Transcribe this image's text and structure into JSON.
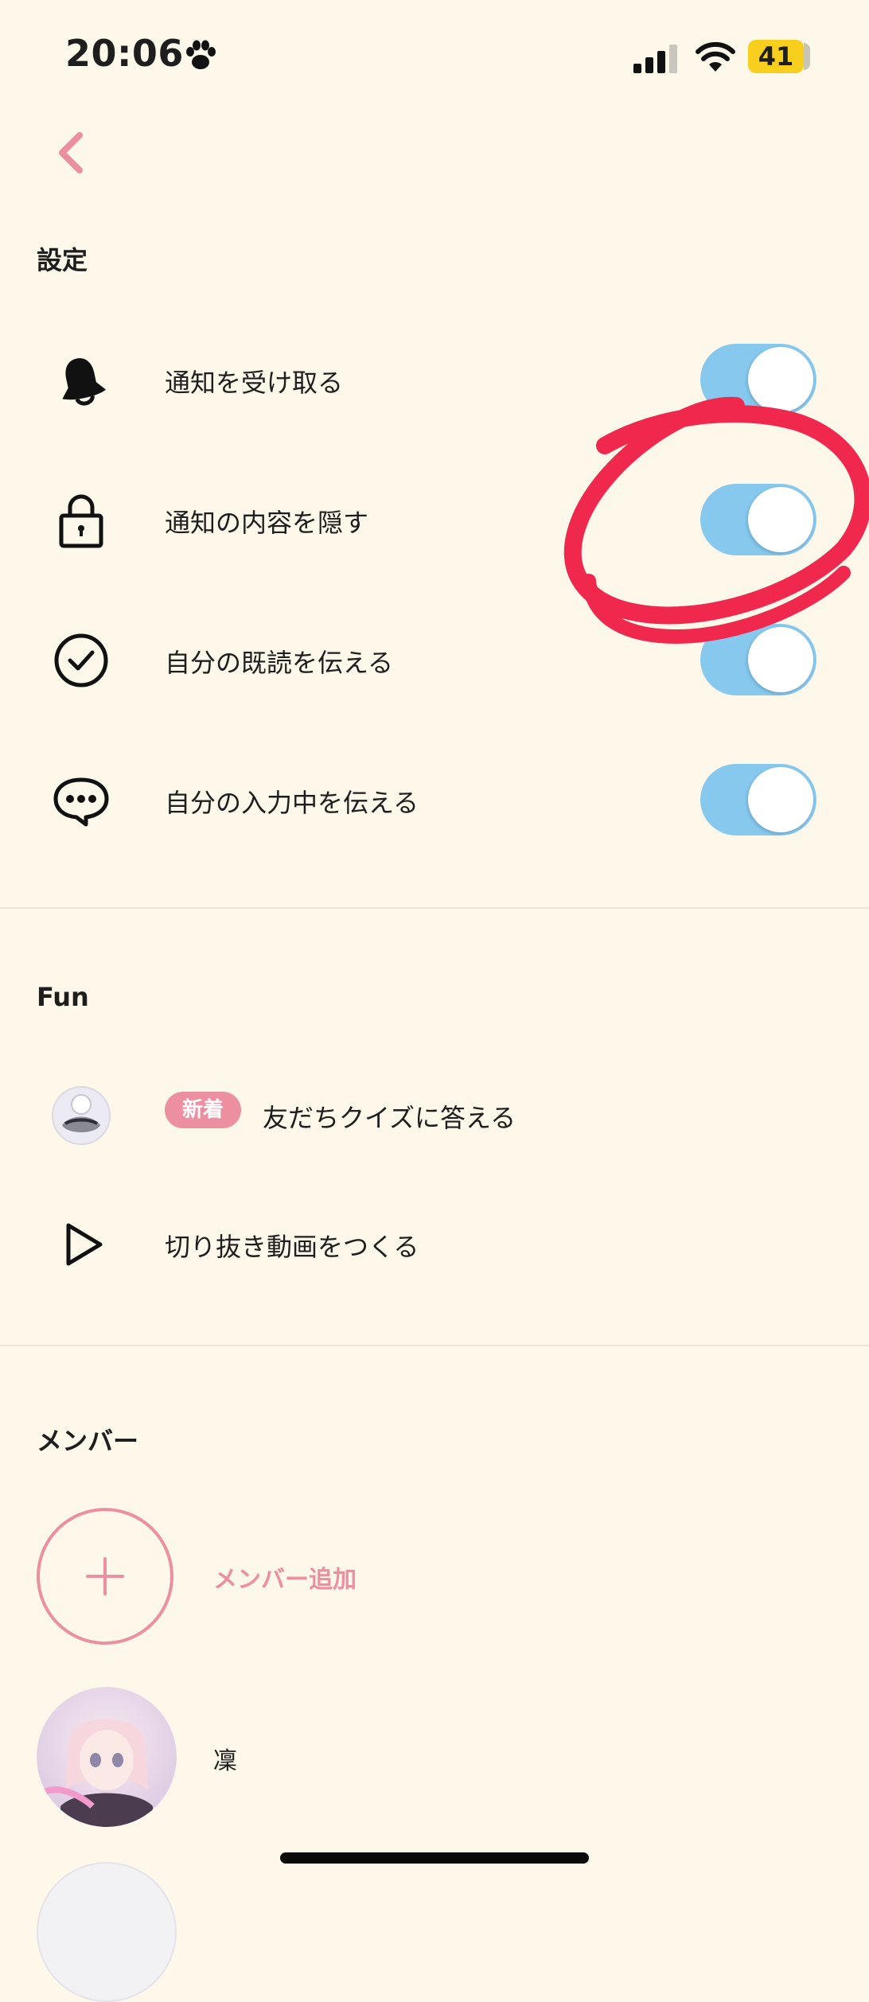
{
  "status_bar": {
    "time": "20:06",
    "battery": "41",
    "icons": [
      "paw-icon",
      "signal-icon",
      "wifi-icon",
      "battery-icon"
    ]
  },
  "nav": {
    "back_icon": "chevron-left-icon"
  },
  "settings": {
    "title": "設定",
    "items": [
      {
        "label": "通知を受け取る",
        "icon": "bell-icon",
        "enabled": true
      },
      {
        "label": "通知の内容を隠す",
        "icon": "lock-icon",
        "enabled": true
      },
      {
        "label": "自分の既読を伝える",
        "icon": "check-circle-icon",
        "enabled": true
      },
      {
        "label": "自分の入力中を伝える",
        "icon": "chat-bubble-icon",
        "enabled": true
      }
    ]
  },
  "fun": {
    "title": "Fun",
    "quiz": {
      "badge": "新着",
      "label": "友だちクイズに答える",
      "icon": "quiz-thumbnail"
    },
    "clip": {
      "label": "切り抜き動画をつくる",
      "icon": "play-icon"
    }
  },
  "members": {
    "title": "メンバー",
    "add_label": "メンバー追加",
    "list": [
      {
        "name": "凜"
      }
    ]
  },
  "colors": {
    "background": "#fdf8ea",
    "accent_pink": "#ec8fa0",
    "toggle_on": "#86c8ee",
    "battery": "#f7cf1c",
    "annotation_red": "#f0284e"
  }
}
